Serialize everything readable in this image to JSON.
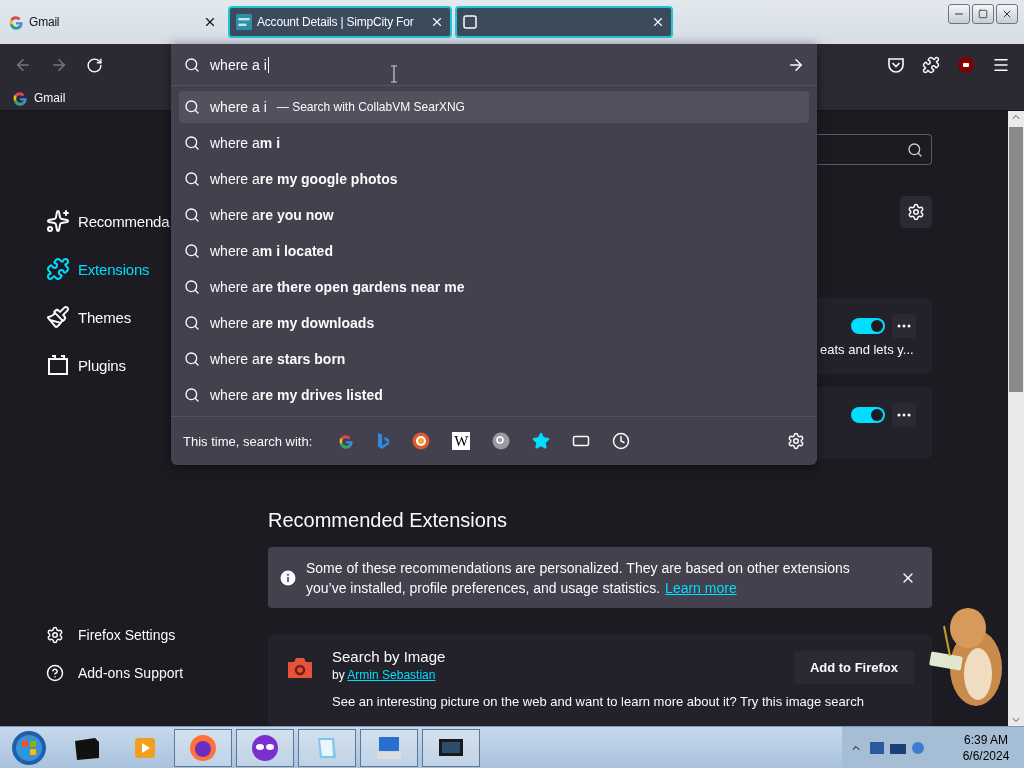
{
  "tabs": [
    {
      "title": "Gmail",
      "selected": false
    },
    {
      "title": "Account Details | SimpCity For",
      "selected": true
    },
    {
      "selected": true
    }
  ],
  "address_bar": {
    "value": "where a i"
  },
  "suggestions": [
    {
      "text": "where a i",
      "hint": "— Search with CollabVM SearXNG",
      "selected": true
    },
    {
      "text": "where a**m i**",
      "selected": false
    },
    {
      "text": "where a**re my google photos**",
      "selected": false
    },
    {
      "text": "where a**re you now**",
      "selected": false
    },
    {
      "text": "where a**m i located**",
      "selected": false
    },
    {
      "text": "where a**re there open gardens near me**",
      "selected": false
    },
    {
      "text": "where a**re my downloads**",
      "selected": false
    },
    {
      "text": "where a**re stars born**",
      "selected": false
    },
    {
      "text": "where a**re my drives listed**",
      "selected": false
    }
  ],
  "search_with": {
    "label": "This time, search with:",
    "wiki_glyph": "W"
  },
  "bookmarks": [
    {
      "label": "Gmail"
    }
  ],
  "sidebar": {
    "items": [
      {
        "label": "Recommenda",
        "kind": "sparkle",
        "selected": false
      },
      {
        "label": "Extensions",
        "kind": "puzzle",
        "selected": true
      },
      {
        "label": "Themes",
        "kind": "brush",
        "selected": false
      },
      {
        "label": "Plugins",
        "kind": "plugin",
        "selected": false
      }
    ],
    "footer": [
      {
        "label": "Firefox Settings",
        "kind": "gear"
      },
      {
        "label": "Add-ons Support",
        "kind": "help"
      }
    ]
  },
  "extensions": [
    {
      "enabled": true,
      "description": "eats and lets y..."
    },
    {
      "enabled": true
    }
  ],
  "recommended": {
    "heading": "Recommended Extensions",
    "notice": "Some of these recommendations are personalized. They are based on other extensions you’ve installed, profile preferences, and usage statistics.",
    "notice_link": "Learn more",
    "addon": {
      "name": "Search by Image",
      "by": "by",
      "author": "Armin Sebastian",
      "button": "Add to Firefox",
      "description": "See an interesting picture on the web and want to learn more about it? Try this image search"
    }
  },
  "taskbar": {
    "time": "6:39 AM",
    "date": "6/6/2024"
  }
}
